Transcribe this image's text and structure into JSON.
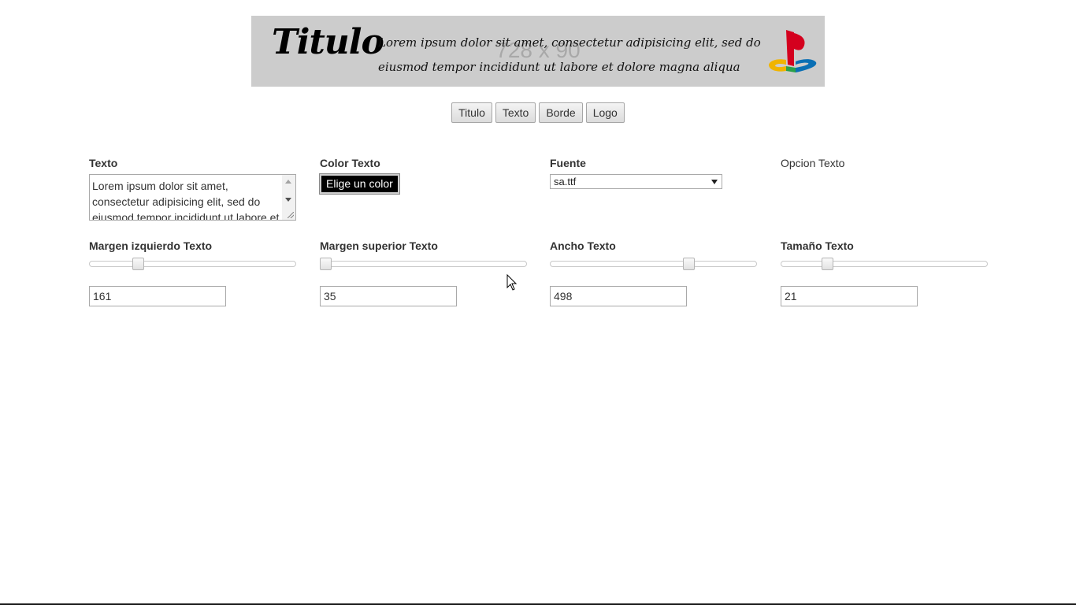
{
  "banner": {
    "placeholder": "728 x 90",
    "title": "Titulo",
    "text": "Lorem ipsum dolor sit amet, consectetur adipisicing elit, sed do eiusmod tempor incididunt ut labore et dolore magna aliqua",
    "logo_icon": "playstation-logo",
    "background": "#cccccc"
  },
  "tabs": [
    {
      "label": "Titulo"
    },
    {
      "label": "Texto"
    },
    {
      "label": "Borde"
    },
    {
      "label": "Logo"
    }
  ],
  "form": {
    "texto": {
      "label": "Texto",
      "value": "Lorem ipsum dolor sit amet, consectetur adipisicing elit, sed do eiusmod tempor incididunt ut labore et"
    },
    "color_texto": {
      "label": "Color Texto",
      "button_label": "Elige un color",
      "selected_color": "#000000"
    },
    "fuente": {
      "label": "Fuente",
      "selected": "sa.ttf"
    },
    "opcion_texto": {
      "label": "Opcion Texto"
    },
    "margen_izquierdo": {
      "label": "Margen izquierdo Texto",
      "value": "161",
      "slider_fraction": 0.22
    },
    "margen_superior": {
      "label": "Margen superior Texto",
      "value": "35",
      "slider_fraction": 0.0
    },
    "ancho": {
      "label": "Ancho Texto",
      "value": "498",
      "slider_fraction": 0.68
    },
    "tamano": {
      "label": "Tamaño Texto",
      "value": "21",
      "slider_fraction": 0.21
    }
  }
}
